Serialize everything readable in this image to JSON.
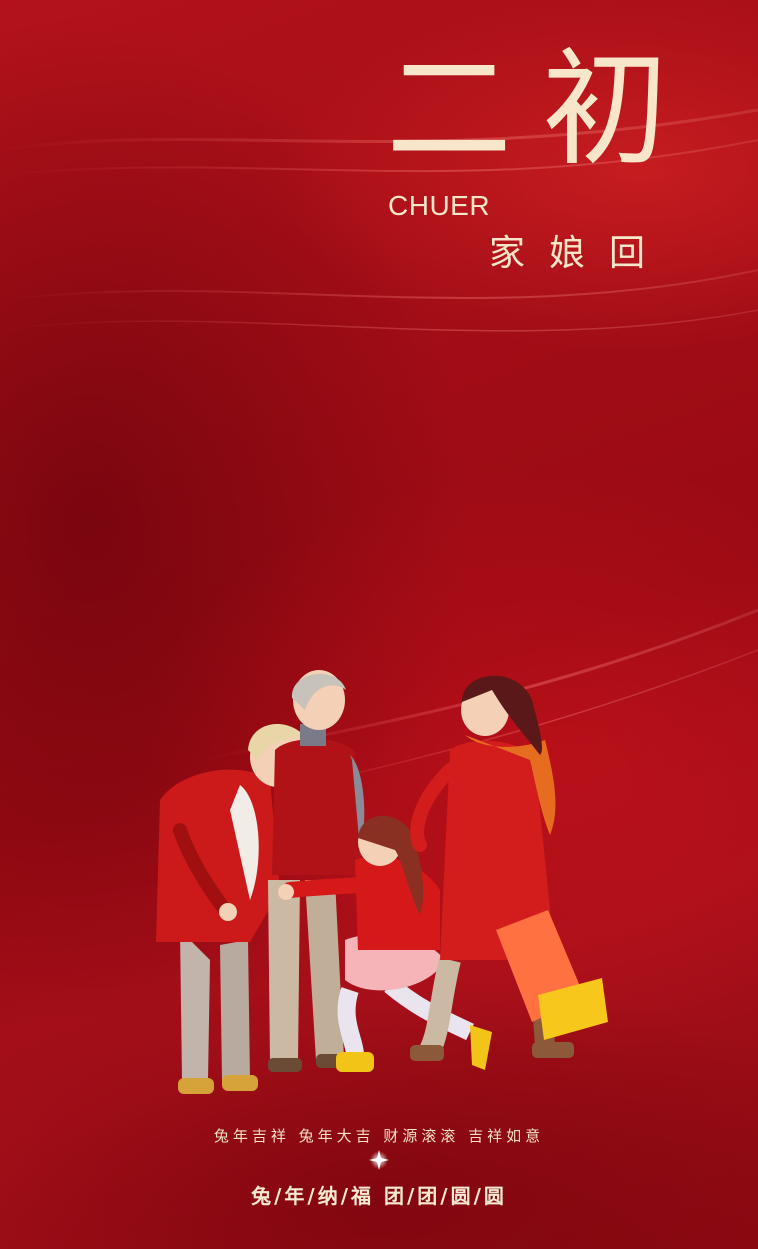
{
  "poster": {
    "title_main": "二初",
    "title_pinyin": "CHUER",
    "title_sub": "家娘回",
    "slogan_line1": "兔年吉祥 兔年大吉 财源滚滚 吉祥如意",
    "slogan_line2": "兔/年/纳/福 团/团/圆/圆"
  },
  "colors": {
    "background_red": "#a30d16",
    "text_cream": "#f7e6c9"
  },
  "icons": {
    "divider_center": "sparkle-icon"
  }
}
